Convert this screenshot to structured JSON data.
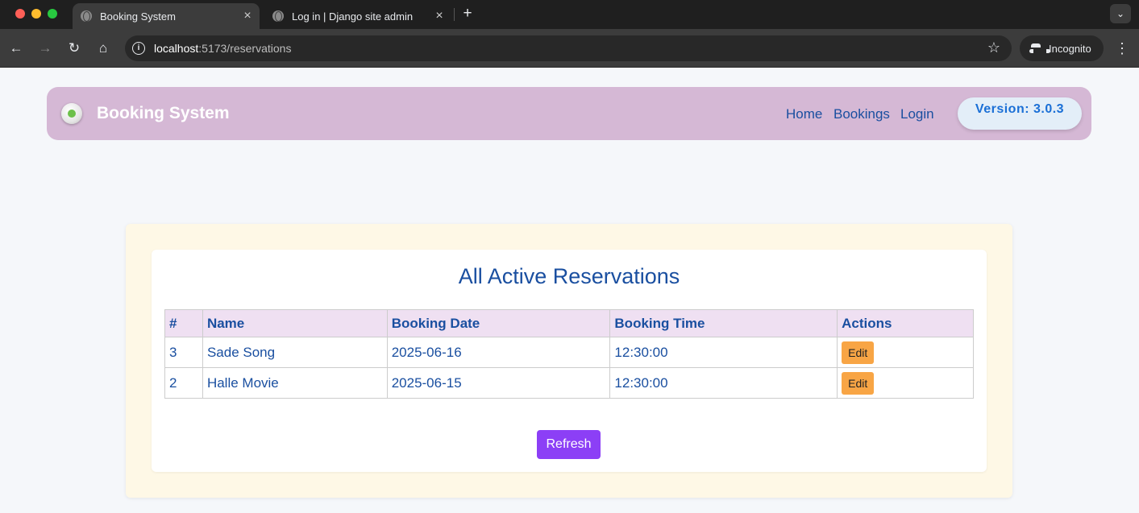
{
  "browser": {
    "tabs": [
      {
        "title": "Booking System",
        "active": true
      },
      {
        "title": "Log in | Django site admin",
        "active": false
      }
    ],
    "url_host": "localhost",
    "url_path": ":5173/reservations",
    "incognito_label": "Incognito"
  },
  "header": {
    "brand": "Booking System",
    "nav": {
      "home": "Home",
      "bookings": "Bookings",
      "login": "Login"
    },
    "version": "Version: 3.0.3"
  },
  "reservations": {
    "title": "All Active Reservations",
    "columns": [
      "#",
      "Name",
      "Booking Date",
      "Booking Time",
      "Actions"
    ],
    "rows": [
      {
        "id": "3",
        "name": "Sade Song",
        "date": "2025-06-16",
        "time": "12:30:00",
        "action": "Edit"
      },
      {
        "id": "2",
        "name": "Halle Movie",
        "date": "2025-06-15",
        "time": "12:30:00",
        "action": "Edit"
      }
    ],
    "refresh_label": "Refresh"
  },
  "colors": {
    "header_bg": "#d5b8d5",
    "accent_blue": "#1a4fa0",
    "edit_button": "#f8a545",
    "refresh_button": "#8c3ff6"
  }
}
